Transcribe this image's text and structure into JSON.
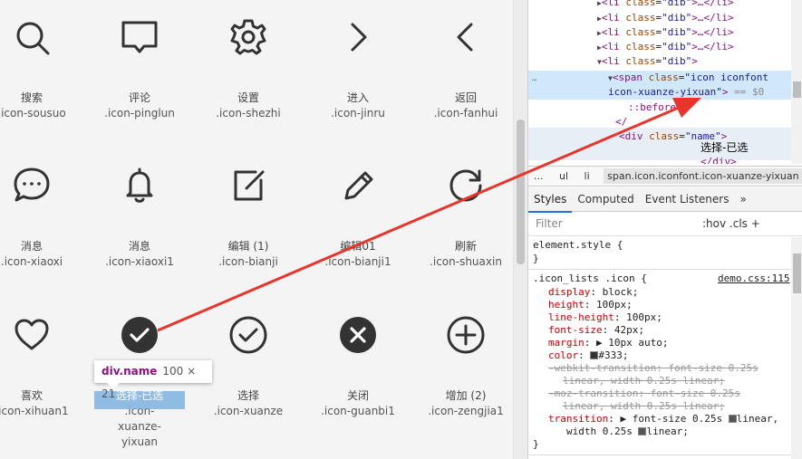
{
  "icon_grid": {
    "rows": [
      [
        {
          "icon": "search-icon",
          "name": "搜索",
          "cls": ".icon-sousuo"
        },
        {
          "icon": "comment-icon",
          "name": "评论",
          "cls": ".icon-pinglun"
        },
        {
          "icon": "settings-gear-icon",
          "name": "设置",
          "cls": ".icon-shezhi"
        },
        {
          "icon": "chevron-right-icon",
          "name": "进入",
          "cls": ".icon-jinru"
        },
        {
          "icon": "chevron-left-icon",
          "name": "返回",
          "cls": ".icon-fanhui"
        }
      ],
      [
        {
          "icon": "message-bubble-icon",
          "name": "消息",
          "cls": ".icon-xiaoxi"
        },
        {
          "icon": "bell-icon",
          "name": "消息",
          "cls": ".icon-xiaoxi1"
        },
        {
          "icon": "edit-icon",
          "name": "编辑 (1)",
          "cls": ".icon-bianji"
        },
        {
          "icon": "pencil-icon",
          "name": "编辑01",
          "cls": ".icon-bianji1"
        },
        {
          "icon": "refresh-icon",
          "name": "刷新",
          "cls": ".icon-shuaxin"
        }
      ],
      [
        {
          "icon": "heart-icon",
          "name": "喜欢",
          "cls": ".icon-xihuan1"
        },
        {
          "icon": "check-filled-icon",
          "name": "选择-已选",
          "cls": ".icon-xuanze-yixuan"
        },
        {
          "icon": "check-circle-icon",
          "name": "选择",
          "cls": ".icon-xuanze"
        },
        {
          "icon": "close-filled-icon",
          "name": "关闭",
          "cls": ".icon-guanbi1"
        },
        {
          "icon": "add-circle-icon",
          "name": "增加 (2)",
          "cls": ".icon-zengjia1"
        }
      ]
    ]
  },
  "inspect_tooltip": {
    "tag": "div.name",
    "size": "100 × 21"
  },
  "devtools": {
    "dom": {
      "li_tag": "li",
      "li_class_attr": "class",
      "li_class_val": "\"dib\"",
      "li_collapsed_suffix": ">…</li>",
      "span_tag": "span",
      "span_class_val": "\"icon iconfont",
      "span_class_val2": "icon-xuanze-yixuan\"",
      "eq_sel": "== $0",
      "before": "::before",
      "close_partial": "</",
      "div_tag": "div",
      "div_class_val": "\"name\"",
      "close_div": "</div>",
      "ellipsis": "…"
    },
    "drag_label": "选择-已选",
    "breadcrumbs": [
      "...",
      "ul",
      "li",
      "span.icon.iconfont.icon-xuanze-yixuan"
    ],
    "tabs": [
      "Styles",
      "Computed",
      "Event Listeners",
      "»"
    ],
    "filter_placeholder": "Filter",
    "filter_controls": ":hov  .cls  +",
    "styles": {
      "element_style": "element.style {",
      "close_brace": "}",
      "rule_selector": ".icon_lists .icon {",
      "rule_source": "demo.css:115",
      "decls": [
        {
          "prop": "display",
          "val": "block;"
        },
        {
          "prop": "height",
          "val": "100px;"
        },
        {
          "prop": "line-height",
          "val": "100px;"
        },
        {
          "prop": "font-size",
          "val": "42px;"
        },
        {
          "prop": "margin",
          "val": "▶ 10px auto;"
        },
        {
          "prop": "color",
          "val": "#333;"
        }
      ],
      "struck": [
        "-webkit-transition: font-size 0.25s",
        "linear, width 0.25s linear;",
        "-moz-transition: font-size 0.25s",
        "linear, width 0.25s linear;"
      ],
      "transition_prop": "transition",
      "transition_val1": "▶ font-size 0.25s",
      "transition_val1b": "linear,",
      "transition_val2": "width 0.25s",
      "transition_val2b": "linear;"
    }
  },
  "colors": {
    "arrow": "#e8352b",
    "tag": "#881280",
    "attr_name": "#994500",
    "attr_val": "#1a1aa6",
    "prop": "#c80000"
  }
}
